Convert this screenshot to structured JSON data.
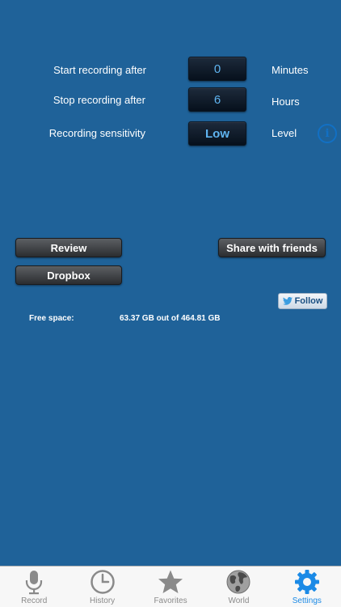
{
  "settings": {
    "start": {
      "label": "Start recording after",
      "value": "0",
      "unit": "Minutes"
    },
    "stop": {
      "label": "Stop recording after",
      "value": "6",
      "unit": "Hours"
    },
    "sensitivity": {
      "label": "Recording sensitivity",
      "value": "Low",
      "unit": "Level"
    }
  },
  "buttons": {
    "review": "Review",
    "share": "Share with friends",
    "dropbox": "Dropbox",
    "follow": "Follow"
  },
  "storage": {
    "label": "Free space:",
    "value": "63.37 GB out of 464.81 GB"
  },
  "tabbar": {
    "items": [
      {
        "label": "Record",
        "icon": "microphone-icon"
      },
      {
        "label": "History",
        "icon": "clock-icon"
      },
      {
        "label": "Favorites",
        "icon": "star-icon"
      },
      {
        "label": "World",
        "icon": "globe-icon"
      },
      {
        "label": "Settings",
        "icon": "gear-icon",
        "active": true
      }
    ],
    "active_color": "#1b8ae6",
    "inactive_color": "#8a8a8a"
  },
  "colors": {
    "background": "#1f6299",
    "value_text": "#5fb4f0",
    "info_icon": "#1270c4"
  }
}
